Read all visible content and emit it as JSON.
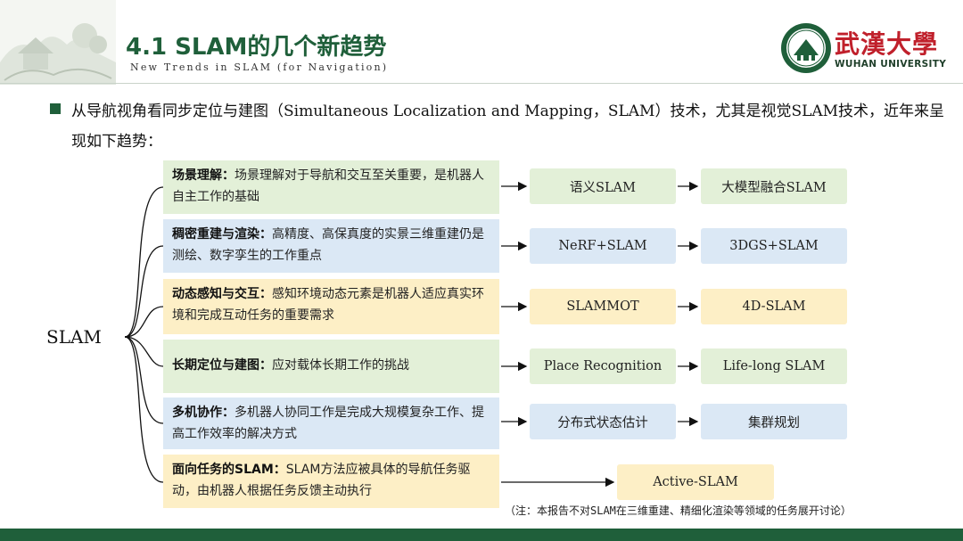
{
  "header": {
    "title": "4.1 SLAM的几个新趋势",
    "subtitle": "New Trends in SLAM (for Navigation)",
    "university_cn": "武漢大學",
    "university_en": "WUHAN UNIVERSITY",
    "logo_icon": "university-seal-icon",
    "header_art_icon": "campus-building-sketch-icon"
  },
  "intro": "从导航视角看同步定位与建图（Simultaneous Localization and Mapping，SLAM）技术，尤其是视觉SLAM技术，近年来呈现如下趋势：",
  "root_label": "SLAM",
  "rows": [
    {
      "heading": "场景理解：",
      "text": "场景理解对于导航和交互至关重要，是机器人自主工作的基础",
      "tag1": "语义SLAM",
      "tag2": "大模型融合SLAM",
      "color": "#e3f0d8"
    },
    {
      "heading": "稠密重建与渲染：",
      "text": "高精度、高保真度的实景三维重建仍是测绘、数字孪生的工作重点",
      "tag1": "NeRF+SLAM",
      "tag2": "3DGS+SLAM",
      "color": "#dbe8f5"
    },
    {
      "heading": "动态感知与交互：",
      "text": "感知环境动态元素是机器人适应真实环境和完成互动任务的重要需求",
      "tag1": "SLAMMOT",
      "tag2": "4D-SLAM",
      "color": "#fdefc6"
    },
    {
      "heading": "长期定位与建图：",
      "text": "应对载体长期工作的挑战",
      "tag1": "Place Recognition",
      "tag2": "Life-long SLAM",
      "color": "#e3f0d8"
    },
    {
      "heading": "多机协作：",
      "text": "多机器人协同工作是完成大规模复杂工作、提高工作效率的解决方式",
      "tag1": "分布式状态估计",
      "tag2": "集群规划",
      "color": "#dbe8f5"
    },
    {
      "heading": "面向任务的SLAM：",
      "text": "SLAM方法应被具体的导航任务驱动，由机器人根据任务反馈主动执行",
      "tag1": "Active-SLAM",
      "color": "#fdefc6"
    }
  ],
  "note": "（注：本报告不对SLAM在三维重建、精细化渲染等领域的任务展开讨论）",
  "colors": {
    "brand_green": "#1f5f3a",
    "brand_red": "#c0202b",
    "footer": "#1f5f3a"
  }
}
